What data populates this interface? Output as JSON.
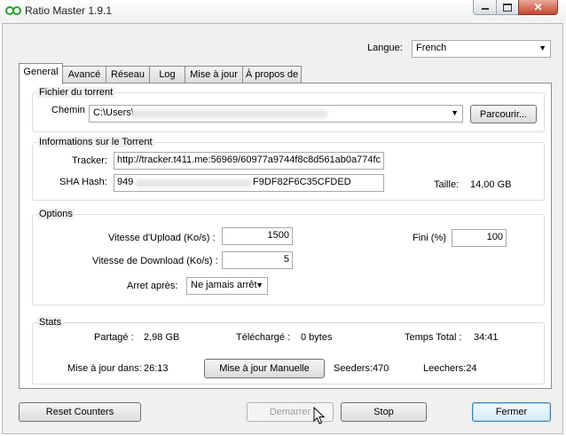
{
  "window": {
    "title": "Ratio Master 1.9.1"
  },
  "language": {
    "label": "Langue:",
    "value": "French"
  },
  "tabs": [
    {
      "label": "General"
    },
    {
      "label": "Avancé"
    },
    {
      "label": "Réseau"
    },
    {
      "label": "Log"
    },
    {
      "label": "Mise à jour"
    },
    {
      "label": "À propos de"
    }
  ],
  "torrent_file": {
    "group_label": "Fichier du torrent",
    "path_label": "Chemin",
    "path_value": "C:\\Users\\",
    "browse_label": "Parcourir..."
  },
  "torrent_info": {
    "group_label": "Informations sur le Torrent",
    "tracker_label": "Tracker:",
    "tracker_value": "http://tracker.t411.me:56969/60977a9744f8c8d561ab0a774fc",
    "hash_label": "SHA Hash:",
    "hash_prefix": "949",
    "hash_suffix": "F9DF82F6C35CFDED",
    "size_label": "Taille:",
    "size_value": "14,00 GB"
  },
  "options": {
    "group_label": "Options",
    "upload_label": "Vitesse d'Upload (Ko/s) :",
    "upload_value": "1500",
    "download_label": "Vitesse de Download (Ko/s) :",
    "download_value": "5",
    "stop_after_label": "Arret après:",
    "stop_after_value": "Ne jamais arrêt",
    "finished_label": "Fini (%)",
    "finished_value": "100"
  },
  "stats": {
    "group_label": "Stats",
    "shared_label": "Partagé :",
    "shared_value": "2,98 GB",
    "downloaded_label": "Téléchargé :",
    "downloaded_value": "0 bytes",
    "total_time_label": "Temps Total :",
    "total_time_value": "34:41",
    "update_in_label": "Mise à jour dans:",
    "update_in_value": "26:13",
    "manual_update_label": "Mise à jour Manuelle",
    "seeders_label": "Seeders:",
    "seeders_value": "470",
    "leechers_label": "Leechers:",
    "leechers_value": "24"
  },
  "buttons": {
    "reset": "Reset Counters",
    "start": "Demarrer",
    "stop": "Stop",
    "close": "Fermer"
  }
}
